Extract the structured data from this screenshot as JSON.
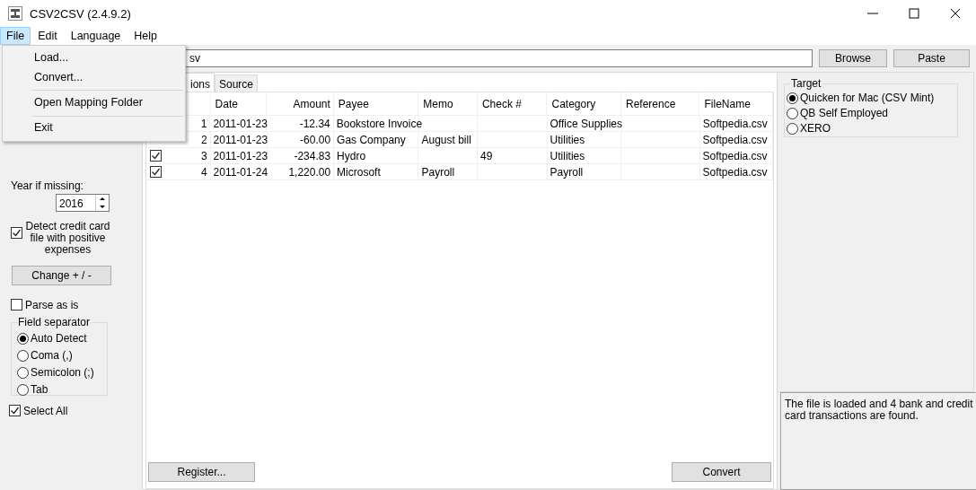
{
  "window": {
    "title": "CSV2CSV (2.4.9.2)"
  },
  "menu": [
    {
      "label": "File",
      "selected": true
    },
    {
      "label": "Edit",
      "selected": false
    },
    {
      "label": "Language",
      "selected": false
    },
    {
      "label": "Help",
      "selected": false
    }
  ],
  "file_menu": {
    "items": [
      {
        "kind": "item",
        "label": "Load..."
      },
      {
        "kind": "item",
        "label": "Convert..."
      },
      {
        "kind": "separator"
      },
      {
        "kind": "item",
        "label": "Open Mapping Folder"
      },
      {
        "kind": "separator"
      },
      {
        "kind": "item",
        "label": "Exit"
      }
    ]
  },
  "left_panel": {
    "year_label": "Year if missing:",
    "year_value": "2016",
    "detect_checkbox": {
      "label": "Detect credit card file with positive expenses",
      "checked": true
    },
    "change_button": "Change + / -",
    "parse_checkbox": {
      "label": "Parse as is",
      "checked": false
    },
    "field_separator": {
      "title": "Field separator",
      "options": [
        {
          "label": "Auto Detect",
          "selected": true
        },
        {
          "label": "Coma (,)",
          "selected": false
        },
        {
          "label": "Semicolon (;)",
          "selected": false
        },
        {
          "label": "Tab",
          "selected": false
        }
      ]
    },
    "select_all": {
      "label": "Select All",
      "checked": true
    }
  },
  "path_field": {
    "value": "sv"
  },
  "browse_button": "Browse",
  "paste_button": "Paste",
  "tabs": [
    {
      "label": "ions",
      "selected": true
    },
    {
      "label": "Source",
      "selected": false
    }
  ],
  "table": {
    "columns": [
      {
        "label": "Date",
        "kind": "text"
      },
      {
        "label": "Amount",
        "kind": "amount"
      },
      {
        "label": "Payee",
        "kind": "text"
      },
      {
        "label": "Memo",
        "kind": "text"
      },
      {
        "label": "Check #",
        "kind": "text"
      },
      {
        "label": "Category",
        "kind": "text"
      },
      {
        "label": "Reference",
        "kind": "text"
      },
      {
        "label": "FileName",
        "kind": "text"
      }
    ],
    "rows": [
      {
        "number": "1",
        "cells": [
          "2011-01-23",
          "-12.34",
          "Bookstore Invoice",
          "",
          "",
          "Office Supplies",
          "",
          "Softpedia.csv"
        ]
      },
      {
        "number": "2",
        "cells": [
          "2011-01-23",
          "-60.00",
          "Gas Company",
          "August bill",
          "",
          "Utilities",
          "",
          "Softpedia.csv"
        ]
      },
      {
        "checked": true,
        "number": "3",
        "cells": [
          "2011-01-23",
          "-234.83",
          "Hydro",
          "",
          "49",
          "Utilities",
          "",
          "Softpedia.csv"
        ]
      },
      {
        "checked": true,
        "number": "4",
        "cells": [
          "2011-01-24",
          "1,220.00",
          "Microsoft",
          "Payroll",
          "",
          "Payroll",
          "",
          "Softpedia.csv"
        ]
      }
    ]
  },
  "register_button": "Register...",
  "convert_button": "Convert",
  "target": {
    "title": "Target",
    "options": [
      {
        "label": "Quicken for Mac (CSV Mint)",
        "selected": true
      },
      {
        "label": "QB Self Employed",
        "selected": false
      },
      {
        "label": "XERO",
        "selected": false
      }
    ]
  },
  "status_text": "The file is loaded and 4 bank and credit card transactions are found."
}
